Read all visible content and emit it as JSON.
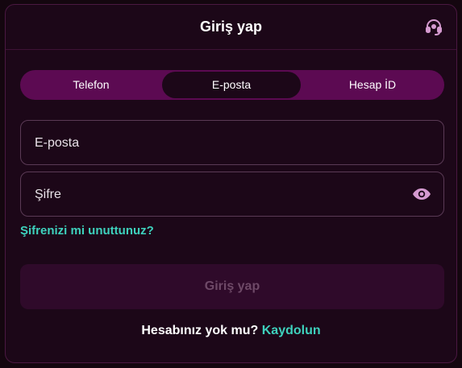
{
  "header": {
    "title": "Giriş yap",
    "support_icon": "headset-icon"
  },
  "tabs": [
    {
      "label": "Telefon",
      "active": false
    },
    {
      "label": "E-posta",
      "active": true
    },
    {
      "label": "Hesap İD",
      "active": false
    }
  ],
  "form": {
    "email": {
      "placeholder": "E-posta",
      "value": ""
    },
    "password": {
      "placeholder": "Şifre",
      "value": "",
      "toggle_icon": "eye-icon"
    },
    "forgot_link": "Şifrenizi mi unuttunuz?",
    "submit_label": "Giriş yap",
    "submit_disabled": true
  },
  "signup": {
    "prompt": "Hesabınız yok mu?",
    "link": "Kaydolun"
  },
  "colors": {
    "background": "#1c0718",
    "tab_track": "#5c0a52",
    "accent": "#3ed1bd",
    "icon": "#d59ad0",
    "disabled_button": "#2f0a2a"
  }
}
